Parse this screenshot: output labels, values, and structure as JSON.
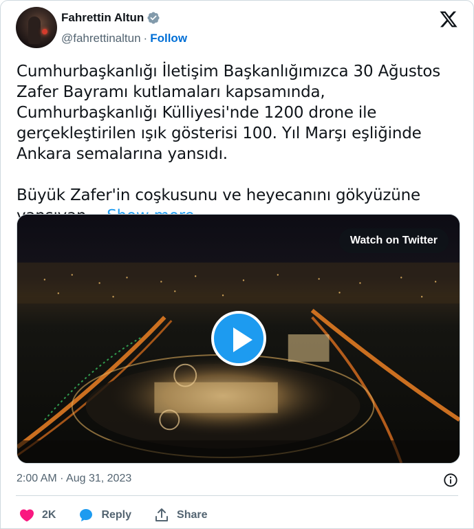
{
  "author": {
    "name": "Fahrettin Altun",
    "handle": "@fahrettinaltun",
    "separator": "·",
    "follow_label": "Follow"
  },
  "tweet": {
    "paragraph1": "Cumhurbaşkanlığı İletişim Başkanlığımızca 30 Ağustos Zafer Bayramı kutlamaları kapsamında, Cumhurbaşkanlığı Külliyesi'nde 1200 drone ile gerçekleştirilen ışık gösterisi 100. Yıl Marşı eşliğinde Ankara semalarına yansıdı.",
    "paragraph2": "Büyük Zafer'in coşkusunu ve heyecanını gökyüzüne yansıyan…",
    "show_more_label": "Show more"
  },
  "media": {
    "watch_label": "Watch on Twitter",
    "play_icon": "play-icon"
  },
  "meta": {
    "timestamp": "2:00 AM · Aug 31, 2023",
    "info_icon": "info-icon"
  },
  "actions": {
    "like_count": "2K",
    "reply_label": "Reply",
    "share_label": "Share"
  },
  "colors": {
    "accent": "#1d9bf0",
    "follow": "#006fd6",
    "like": "#f91880",
    "muted": "#536471",
    "text": "#0f1419"
  }
}
